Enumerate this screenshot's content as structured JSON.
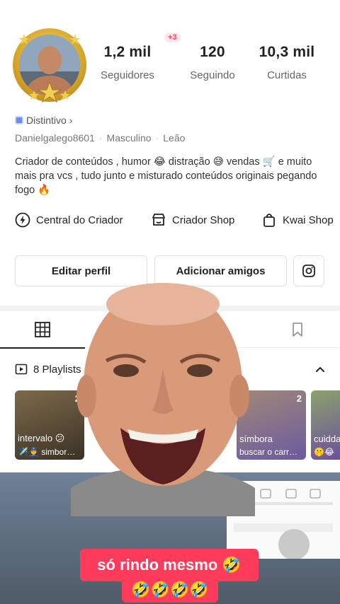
{
  "profile": {
    "stats": [
      {
        "value": "1,2 mil",
        "label": "Seguidores"
      },
      {
        "value": "120",
        "label": "Seguindo"
      },
      {
        "value": "10,3 mil",
        "label": "Curtidas"
      }
    ],
    "new_badge": "+3",
    "distintivo_label": "Distintivo",
    "distintivo_chevron": "›",
    "username": "Danielgalego8601",
    "gender": "Masculino",
    "sign": "Leão",
    "bio": "Criador de conteúdos , humor 😂 distração 😅 vendas 🛒 e muito mais pra vcs , tudo junto e misturado conteúdos originais pegando fogo 🔥"
  },
  "links": [
    {
      "label": "Central do Criador",
      "icon": "lightning-icon"
    },
    {
      "label": "Criador Shop",
      "icon": "shop-icon"
    },
    {
      "label": "Kwai Shop",
      "icon": "bag-icon"
    }
  ],
  "buttons": {
    "edit_profile": "Editar perfil",
    "add_friends": "Adicionar amigos",
    "instagram_icon": "instagram-icon"
  },
  "tabs": [
    {
      "icon": "grid-icon",
      "active": true
    },
    {
      "icon": "heart-icon",
      "active": false
    },
    {
      "icon": "lock-icon",
      "active": false
    },
    {
      "icon": "bookmark-icon",
      "active": false
    }
  ],
  "playlists": {
    "label": "8 Playlists",
    "cards": [
      {
        "count": "2",
        "title": "intervalo 😕",
        "subtitle": "✈️👮 simbor…"
      },
      {
        "count": "2",
        "title": "símbora",
        "subtitle": "buscar o carr…"
      },
      {
        "count": "",
        "title": "cuidda",
        "subtitle": "🤫😂"
      }
    ]
  },
  "overlay": {
    "caption_line1": "só rindo mesmo 🤣",
    "caption_line2": "🤣🤣🤣🤣"
  },
  "colors": {
    "accent": "#ff3b5c",
    "distintivo": "#6b8bf5",
    "avatar_gold": "#d9a82a"
  }
}
